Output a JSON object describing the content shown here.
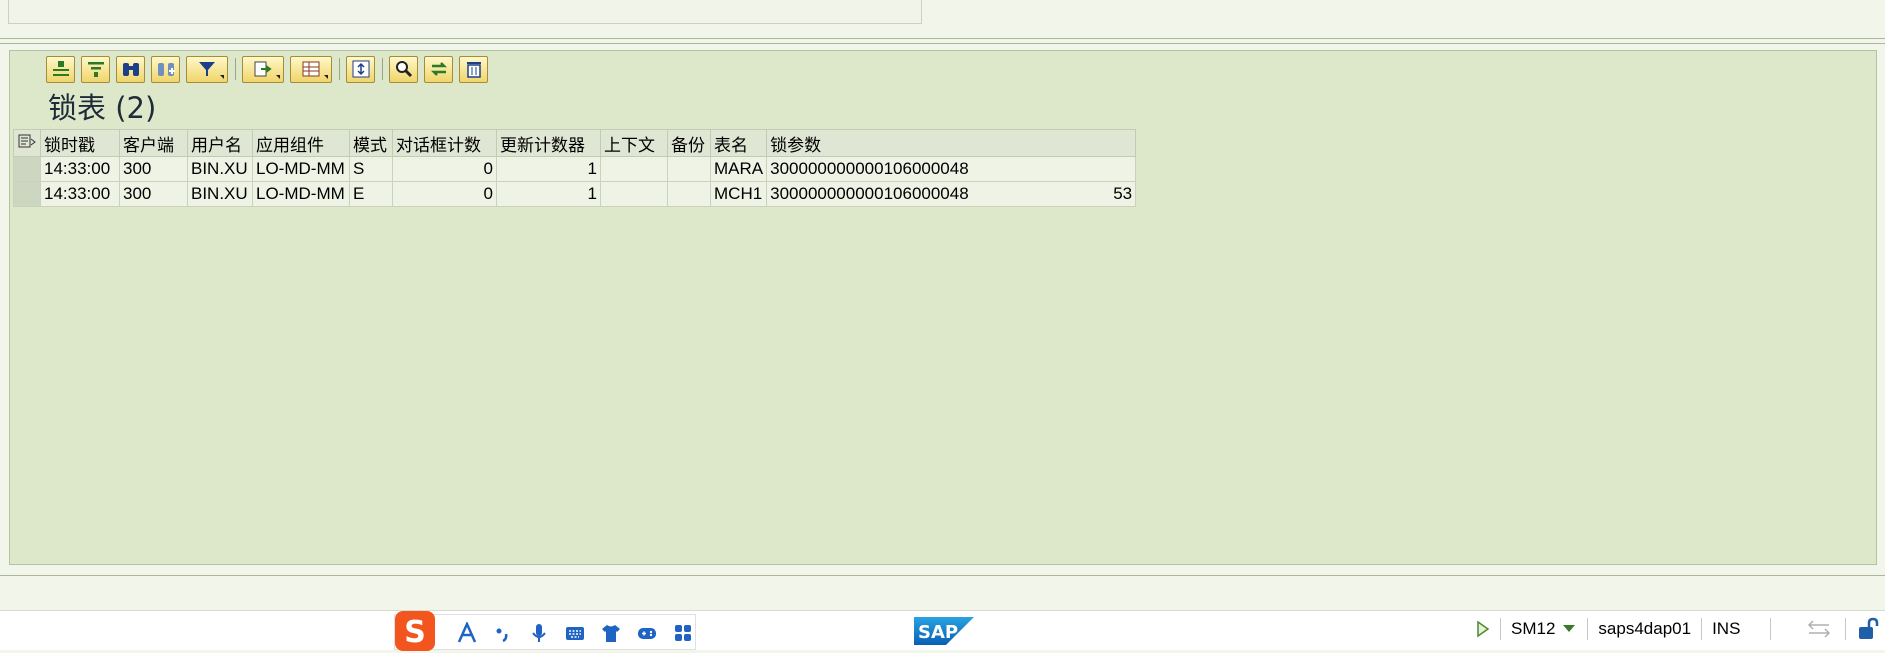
{
  "title": "锁表 (2)",
  "toolbar": {
    "buttons": [
      "details",
      "refresh",
      "find",
      "find-next",
      "filter",
      "export",
      "layout",
      "select-all",
      "inspect",
      "transfer",
      "delete"
    ]
  },
  "table": {
    "headers": [
      "锁时戳",
      "客户端",
      "用户名",
      "应用组件",
      "模式",
      "对话框计数",
      "更新计数器",
      "上下文",
      "备份",
      "表名",
      "锁参数"
    ],
    "rows": [
      {
        "time": "14:33:00",
        "client": "300",
        "user": "BIN.XU",
        "component": "LO-MD-MM",
        "mode": "S",
        "dialog": "0",
        "update": "1",
        "context": "",
        "backup": "",
        "table": "MARA",
        "lockarg": "300000000000106000048",
        "extra": ""
      },
      {
        "time": "14:33:00",
        "client": "300",
        "user": "BIN.XU",
        "component": "LO-MD-MM",
        "mode": "E",
        "dialog": "0",
        "update": "1",
        "context": "",
        "backup": "",
        "table": "MCH1",
        "lockarg": "300000000000106000048",
        "extra": "53"
      }
    ]
  },
  "status": {
    "transaction": "SM12",
    "server": "saps4dap01",
    "mode": "INS",
    "brand": "SAP",
    "ime": "S"
  }
}
